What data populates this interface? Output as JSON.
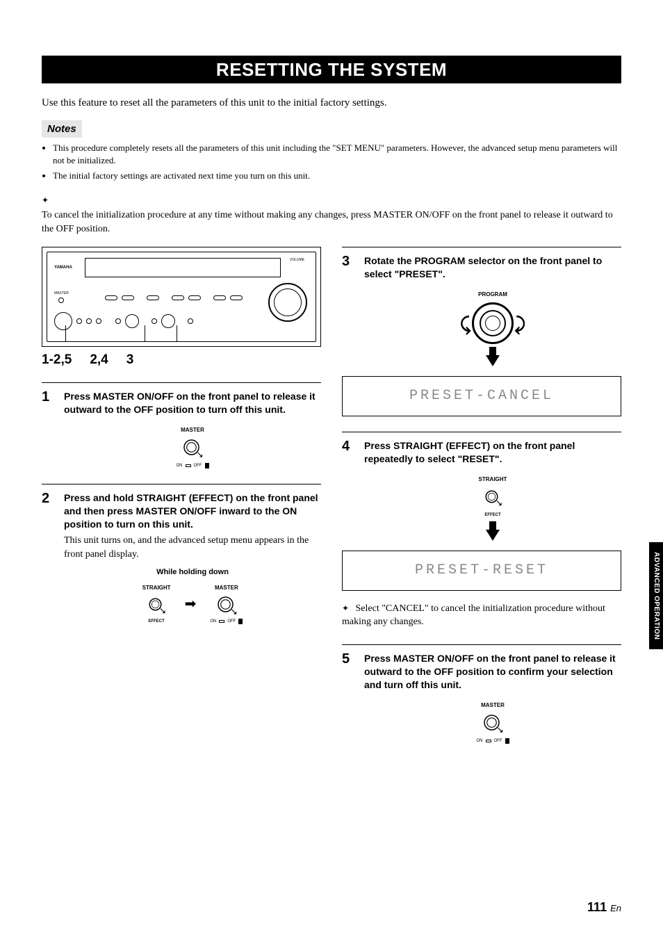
{
  "title": "RESETTING THE SYSTEM",
  "intro": "Use this feature to reset all the parameters of this unit to the initial factory settings.",
  "notes_label": "Notes",
  "notes": [
    "This procedure completely resets all the parameters of this unit including the \"SET MENU\" parameters. However, the advanced setup menu parameters will not be initialized.",
    "The initial factory settings are activated next time you turn on this unit."
  ],
  "precancel_tip": "To cancel the initialization procedure at any time without making any changes, press MASTER ON/OFF on the front panel to release it outward to the OFF position.",
  "device": {
    "brand": "YAMAHA",
    "volume_label": "VOLUME",
    "callouts": [
      "1-2,5",
      "2,4",
      "3"
    ]
  },
  "labels": {
    "master": "MASTER",
    "on": "ON",
    "off": "OFF",
    "straight": "STRAIGHT",
    "effect": "EFFECT",
    "program": "PROGRAM",
    "while_holding": "While holding down"
  },
  "steps": {
    "s1": {
      "num": "1",
      "title": "Press MASTER ON/OFF on the front panel to release it outward to the OFF position to turn off this unit."
    },
    "s2": {
      "num": "2",
      "title": "Press and hold STRAIGHT (EFFECT) on the front panel and then press MASTER ON/OFF inward to the ON position to turn on this unit.",
      "desc": "This unit turns on, and the advanced setup menu appears in the front panel display."
    },
    "s3": {
      "num": "3",
      "title": "Rotate the PROGRAM selector on the front panel to select \"PRESET\".",
      "lcd": "PRESET-CANCEL"
    },
    "s4": {
      "num": "4",
      "title": "Press STRAIGHT (EFFECT) on the front panel repeatedly to select \"RESET\".",
      "lcd": "PRESET-RESET",
      "tip": "Select \"CANCEL\" to cancel the initialization procedure without making any changes."
    },
    "s5": {
      "num": "5",
      "title": "Press MASTER ON/OFF on the front panel to release it outward to the OFF position to confirm your selection and turn off this unit."
    }
  },
  "side_tab": "ADVANCED OPERATION",
  "page_number": "111",
  "page_lang": "En"
}
